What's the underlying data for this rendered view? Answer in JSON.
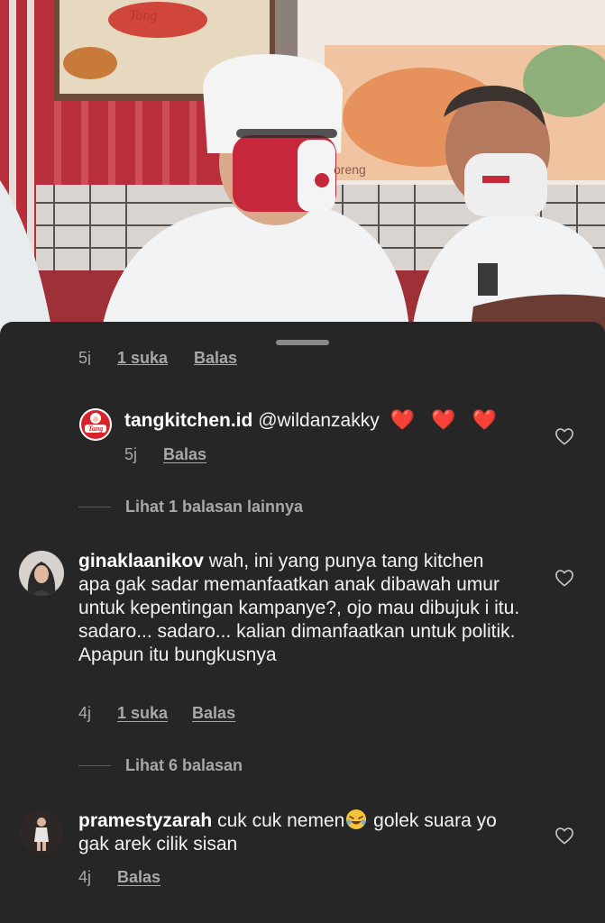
{
  "sheet": {
    "cut_meta": {
      "time": "5j",
      "likes": "1 suka",
      "reply": "Balas"
    }
  },
  "reply1": {
    "username": "tangkitchen.id",
    "text": "@wildanzakky",
    "emoji": "❤️ ❤️ ❤️",
    "time": "5j",
    "reply_label": "Balas"
  },
  "more1": {
    "label": "Lihat 1 balasan lainnya"
  },
  "comment1": {
    "username": "ginaklaanikov",
    "text": "wah, ini yang punya tang kitchen apa gak sadar memanfaatkan anak dibawah umur untuk kepentingan kampanye?, ojo mau dibujuk i itu. sadaro... sadaro... kalian dimanfaatkan untuk politik. Apapun itu bungkusnya",
    "time": "4j",
    "likes": "1 suka",
    "reply_label": "Balas"
  },
  "more2": {
    "label": "Lihat 6 balasan"
  },
  "comment2": {
    "username": "pramestyzarah",
    "text_before_emoji": "cuk cuk nemen",
    "emoji": "🤣",
    "text_after_emoji": " golek suara yo gak arek cilik sisan",
    "time": "4j",
    "reply_label": "Balas"
  },
  "icons": {
    "heart": "heart-outline-icon",
    "brand_avatar": "tang-logo-icon"
  },
  "colors": {
    "sheet_bg": "#262626",
    "muted": "#a8a8a8",
    "heart_red": "#e8312f"
  }
}
